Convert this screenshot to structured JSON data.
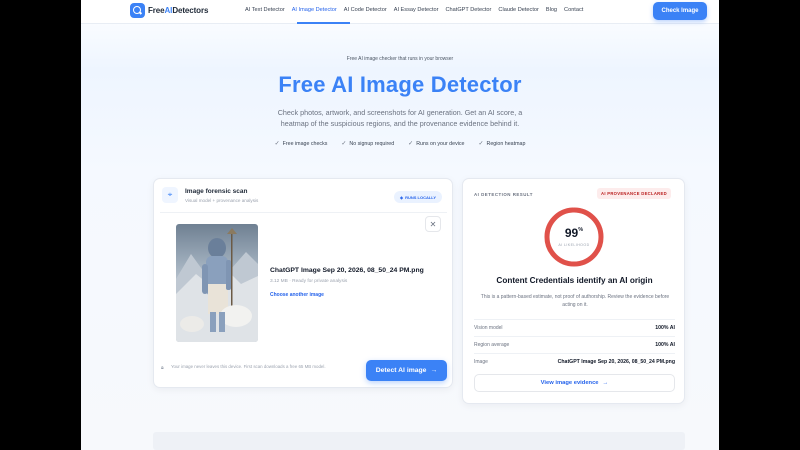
{
  "nav": {
    "logo_prefix": "Free",
    "logo_highlight": "AI",
    "logo_suffix": "Detectors",
    "links": [
      {
        "label": "AI Text Detector",
        "active": false
      },
      {
        "label": "AI Image Detector",
        "active": true
      },
      {
        "label": "AI Code Detector",
        "active": false
      },
      {
        "label": "AI Essay Detector",
        "active": false
      },
      {
        "label": "ChatGPT Detector",
        "active": false
      },
      {
        "label": "Claude Detector",
        "active": false
      },
      {
        "label": "Blog",
        "active": false
      },
      {
        "label": "Contact",
        "active": false
      }
    ],
    "cta_label": "Check Image"
  },
  "hero": {
    "eyebrow": "Free AI image checker that runs in your browser",
    "title": "Free AI Image Detector",
    "subtitle": "Check photos, artwork, and screenshots for AI generation. Get an AI score, a heatmap of the suspicious regions, and the provenance evidence behind it.",
    "features": [
      "Free image checks",
      "No signup required",
      "Runs on your device",
      "Region heatmap"
    ]
  },
  "scan_card": {
    "title": "Image forensic scan",
    "subtitle": "Visual model + provenance analysis",
    "badge": "RUNS LOCALLY",
    "file_name": "ChatGPT Image Sep 20, 2026, 08_50_24 PM.png",
    "file_meta": "3.12 MB · Ready for private analysis",
    "choose_link": "Choose another image",
    "footer_note": "Your image never leaves this device. First scan downloads a free 65 MB model.",
    "detect_label": "Detect AI image"
  },
  "result_card": {
    "label": "AI DETECTION RESULT",
    "badge": "AI PROVENANCE DECLARED",
    "score_value": "99",
    "score_unit": "%",
    "score_fraction": 0.99,
    "score_caption": "AI LIKELIHOOD",
    "verdict": "Content Credentials identify an AI origin",
    "disclaimer": "This is a pattern-based estimate, not proof of authorship. Review the evidence before acting on it.",
    "rows": [
      {
        "key": "Vision model",
        "value": "100% AI"
      },
      {
        "key": "Region average",
        "value": "100% AI"
      },
      {
        "key": "Image",
        "value": "ChatGPT Image Sep 20, 2026, 08_50_24 PM.png"
      }
    ],
    "evidence_label": "View image evidence"
  },
  "colors": {
    "accent": "#3b82f6",
    "gauge_red": "#e0514a",
    "badge_red_bg": "#fdecec"
  }
}
